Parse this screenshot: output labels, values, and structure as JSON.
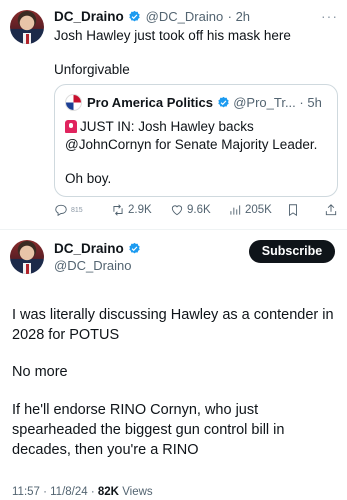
{
  "post1": {
    "author_name": "DC_Draino",
    "author_handle": "@DC_Draino",
    "time": "· 2h",
    "more_label": "···",
    "text": "Josh Hawley just took off his mask here",
    "extra_text": "Unforgivable",
    "quote": {
      "author_name": "Pro America Politics",
      "author_handle": "@Pro_Tr...",
      "time": "· 5h",
      "line1": "JUST IN: Josh Hawley backs",
      "line2": "@JohnCornyn for Senate Majority Leader.",
      "line3": "Oh boy."
    },
    "actions": {
      "replies": "815",
      "reposts": "2.9K",
      "likes": "9.6K",
      "views": "205K"
    }
  },
  "post2": {
    "author_name": "DC_Draino",
    "author_handle": "@DC_Draino",
    "subscribe_label": "Subscribe",
    "paragraph1_line1": "I was literally discussing Hawley as a contender in",
    "paragraph1_line2": "2028 for POTUS",
    "paragraph2": "No more",
    "paragraph3_line1": "If he'll endorse RINO Cornyn, who just",
    "paragraph3_line2": "spearheaded the biggest gun control bill in",
    "paragraph3_line3": "decades, then you're a RINO",
    "timestamp": "11:57 · 11/8/24 · ",
    "views_count": "82K",
    "views_label": " Views"
  },
  "colors": {
    "verified": "#1d9bf0",
    "text": "#0f1419",
    "secondary": "#536471",
    "border": "#cfd9de"
  }
}
